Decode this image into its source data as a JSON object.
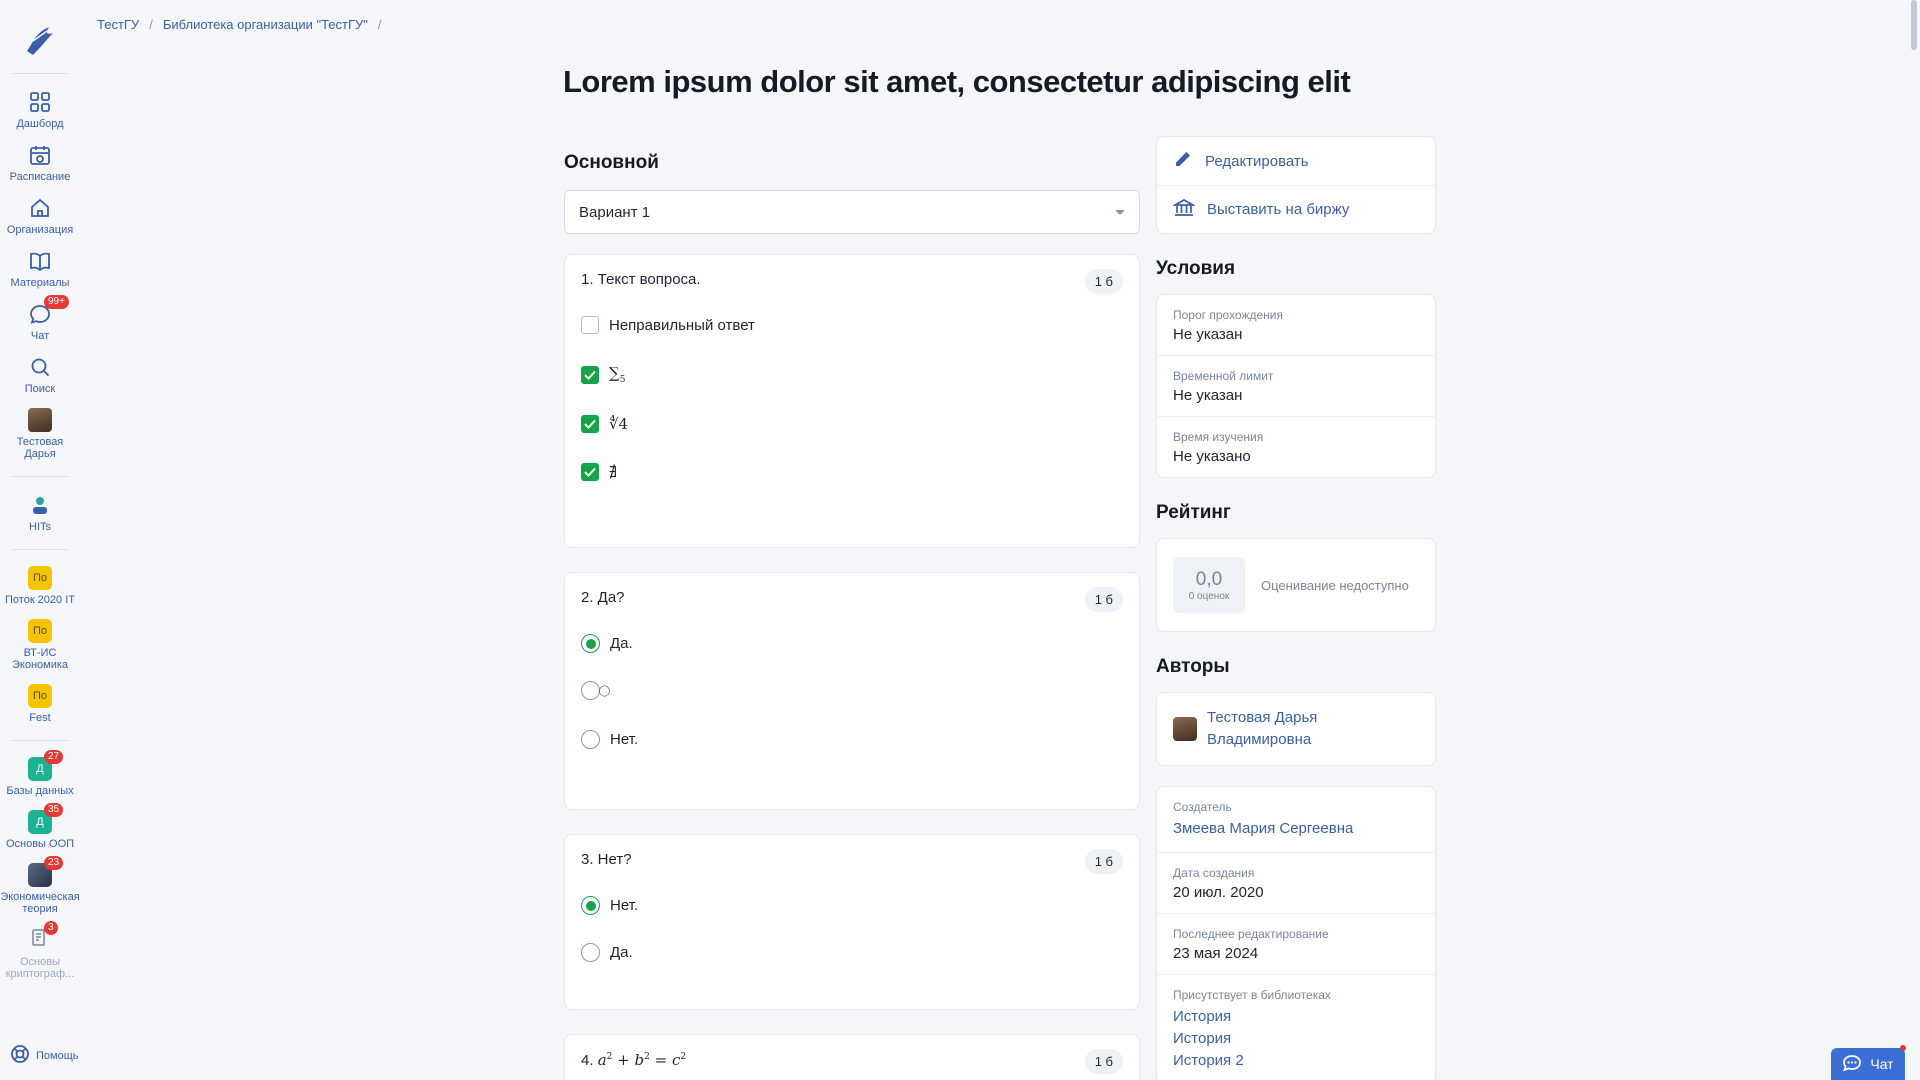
{
  "breadcrumb": {
    "items": [
      "ТестГУ",
      "Библиотека организации \"ТестГУ\""
    ],
    "separator": "/"
  },
  "page": {
    "title": "Lorem ipsum dolor sit amet, consectetur adipiscing elit"
  },
  "sidebar": {
    "items": [
      {
        "label": "Дашборд",
        "icon": "grid-icon"
      },
      {
        "label": "Расписание",
        "icon": "calendar-icon"
      },
      {
        "label": "Организация",
        "icon": "home-icon"
      },
      {
        "label": "Материалы",
        "icon": "book-icon"
      },
      {
        "label": "Чат",
        "icon": "chat-icon",
        "badge": "99+"
      },
      {
        "label": "Поиск",
        "icon": "search-icon"
      },
      {
        "label": "Тестовая Дарья",
        "icon": "avatar"
      }
    ],
    "org": {
      "label": "HITs"
    },
    "groups": [
      {
        "label": "Поток 2020 IT",
        "short": "По"
      },
      {
        "label": "ВТ-ИС Экономика",
        "short": "По"
      },
      {
        "label": "Fest",
        "short": "По"
      }
    ],
    "courses": [
      {
        "label": "Базы данных",
        "short": "Д",
        "badge": "27"
      },
      {
        "label": "Основы ООП",
        "short": "Д",
        "badge": "35"
      },
      {
        "label": "Экономическая теория",
        "badge": "23"
      },
      {
        "label": "Основы криптограф...",
        "badge": "3"
      }
    ],
    "help": "Помощь"
  },
  "main": {
    "section_title": "Основной",
    "variant": "Вариант 1",
    "questions": [
      {
        "text": "1. Текст вопроса.",
        "score": "1 б",
        "options": [
          "Неправильный ответ",
          "∑",
          "5",
          "∜4",
          "∄"
        ]
      },
      {
        "text": "2. Да?",
        "score": "1 б",
        "options": [
          "Да.",
          "⃝⃝⃝",
          "Нет."
        ]
      },
      {
        "text": "3. Нет?",
        "score": "1 б",
        "options": [
          "Нет.",
          "Да."
        ]
      },
      {
        "text": "4.",
        "score": "1 б",
        "formula": {
          "a": "a",
          "b": "b",
          "c": "c",
          "exp": "2",
          "plus": "+",
          "eq": "="
        }
      }
    ]
  },
  "actions": {
    "edit": "Редактировать",
    "exchange": "Выставить на биржу"
  },
  "conditions": {
    "title": "Условия",
    "fields": [
      {
        "label": "Порог прохождения",
        "value": "Не указан"
      },
      {
        "label": "Временной лимит",
        "value": "Не указан"
      },
      {
        "label": "Время изучения",
        "value": "Не указано"
      }
    ]
  },
  "rating": {
    "title": "Рейтинг",
    "value": "0,0",
    "count": "0 оценок",
    "note": "Оценивание недоступно"
  },
  "authors": {
    "title": "Авторы",
    "items": [
      {
        "name": "Тестовая Дарья Владимировна"
      }
    ]
  },
  "meta": {
    "creator_label": "Создатель",
    "creator": "Змеева Мария Сергеевна",
    "created_label": "Дата создания",
    "created": "20 июл. 2020",
    "edited_label": "Последнее редактирование",
    "edited": "23 мая 2024",
    "libraries_label": "Присутствует в библиотеках",
    "libraries": [
      "История",
      "История",
      "История 2"
    ]
  },
  "chat_button": "Чат",
  "colors": {
    "accent": "#3b5ea8",
    "success": "#17a34a",
    "badge": "#e53935",
    "chat": "#3b6fd6"
  }
}
